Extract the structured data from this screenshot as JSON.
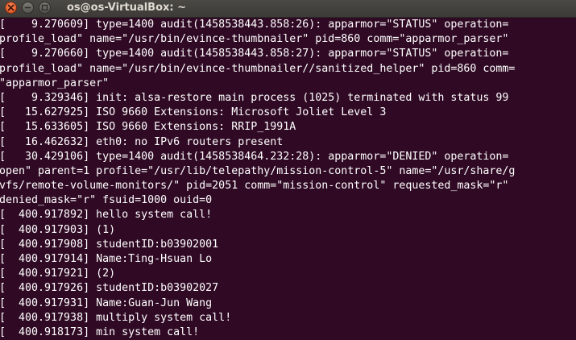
{
  "window": {
    "title": "os@os-VirtualBox: ~"
  },
  "icons": {
    "close": "close-icon",
    "minimize": "minimize-icon",
    "maximize": "maximize-icon"
  },
  "colors": {
    "terminal_background": "#300a24",
    "terminal_text": "#ffffff",
    "titlebar": "#3c3b37",
    "close_button": "#df4a16"
  },
  "terminal": {
    "lines": [
      "[    9.270609] type=1400 audit(1458538443.858:26): apparmor=\"STATUS\" operation=",
      "profile_load\" name=\"/usr/bin/evince-thumbnailer\" pid=860 comm=\"apparmor_parser\"",
      "[    9.270660] type=1400 audit(1458538443.858:27): apparmor=\"STATUS\" operation=",
      "profile_load\" name=\"/usr/bin/evince-thumbnailer//sanitized_helper\" pid=860 comm=",
      "\"apparmor_parser\"",
      "[    9.329346] init: alsa-restore main process (1025) terminated with status 99",
      "[   15.627925] ISO 9660 Extensions: Microsoft Joliet Level 3",
      "[   15.633605] ISO 9660 Extensions: RRIP_1991A",
      "[   16.462632] eth0: no IPv6 routers present",
      "[   30.429106] type=1400 audit(1458538464.232:28): apparmor=\"DENIED\" operation=",
      "open\" parent=1 profile=\"/usr/lib/telepathy/mission-control-5\" name=\"/usr/share/g",
      "vfs/remote-volume-monitors/\" pid=2051 comm=\"mission-control\" requested_mask=\"r\"",
      "denied_mask=\"r\" fsuid=1000 ouid=0",
      "[  400.917892] hello system call!",
      "[  400.917903] (1)",
      "[  400.917908] studentID:b03902001",
      "[  400.917914] Name:Ting-Hsuan Lo",
      "[  400.917921] (2)",
      "[  400.917926] studentID:b03902027",
      "[  400.917931] Name:Guan-Jun Wang",
      "[  400.917938] multiply system call!",
      "[  400.918173] min system call!"
    ]
  }
}
